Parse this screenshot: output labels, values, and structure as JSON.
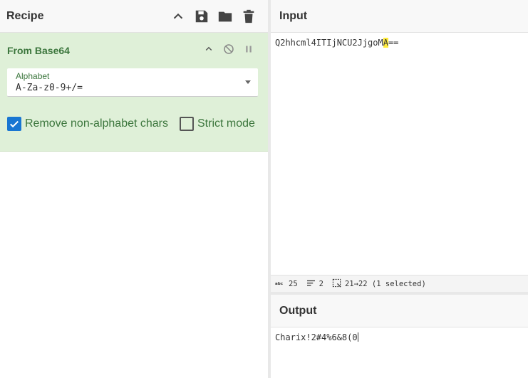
{
  "recipe": {
    "title": "Recipe",
    "icons": [
      "chevron-up-icon",
      "save-icon",
      "folder-icon",
      "trash-icon"
    ],
    "operation": {
      "name": "From Base64",
      "alphabet_label": "Alphabet",
      "alphabet_value": "A-Za-z0-9+/=",
      "remove_label": "Remove non-alphabet chars",
      "remove_checked": true,
      "strict_label": "Strict mode",
      "strict_checked": false
    }
  },
  "input": {
    "title": "Input",
    "text_before": "Q2hhcml4ITIjNCU2JjgoM",
    "text_selected": "A",
    "text_after": "==",
    "status": {
      "length": "25",
      "lines": "2",
      "selection": "21→22 (1 selected)"
    }
  },
  "output": {
    "title": "Output",
    "text": "Charix!2#4%6&8(0"
  },
  "colors": {
    "op_bg": "#dff0d8",
    "op_text": "#3c763d",
    "checkbox_on": "#1976d2",
    "selection": "#ffeb3b"
  }
}
